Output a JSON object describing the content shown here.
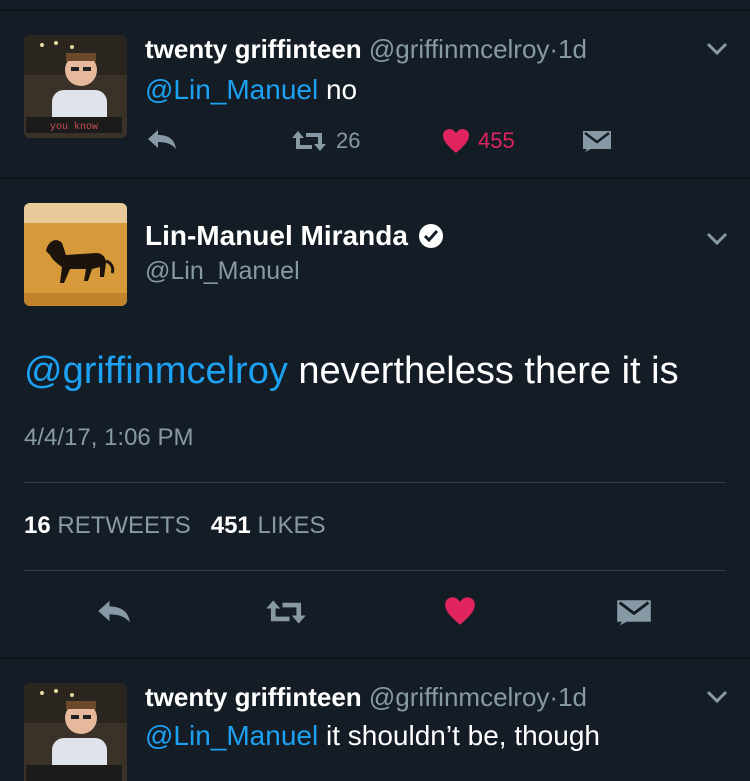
{
  "tweets": [
    {
      "name": "twenty griffinteen",
      "handle": "@griffinmcelroy",
      "dot": "·",
      "time": "1d",
      "mention": "@Lin_Manuel",
      "text": "no",
      "retweets": "26",
      "likes": "455",
      "avatar_banner": "you know"
    },
    {
      "name": "twenty griffinteen",
      "handle": "@griffinmcelroy",
      "dot": "·",
      "time": "1d",
      "mention": "@Lin_Manuel",
      "text": "it shouldn’t be, though"
    }
  ],
  "focus": {
    "name": "Lin-Manuel Miranda",
    "handle": "@Lin_Manuel",
    "mention": "@griffinmcelroy",
    "text": "nevertheless there it is",
    "timestamp": "4/4/17, 1:06 PM",
    "retweet_count": "16",
    "retweet_label": "RETWEETS",
    "like_count": "451",
    "like_label": "LIKES"
  },
  "colors": {
    "background": "#141d26",
    "link": "#1da1f2",
    "muted": "#8899a6",
    "like": "#e0245e"
  },
  "icons": [
    "reply-icon",
    "retweet-icon",
    "heart-icon",
    "message-icon",
    "chevron-down-icon",
    "verified-badge-icon"
  ]
}
